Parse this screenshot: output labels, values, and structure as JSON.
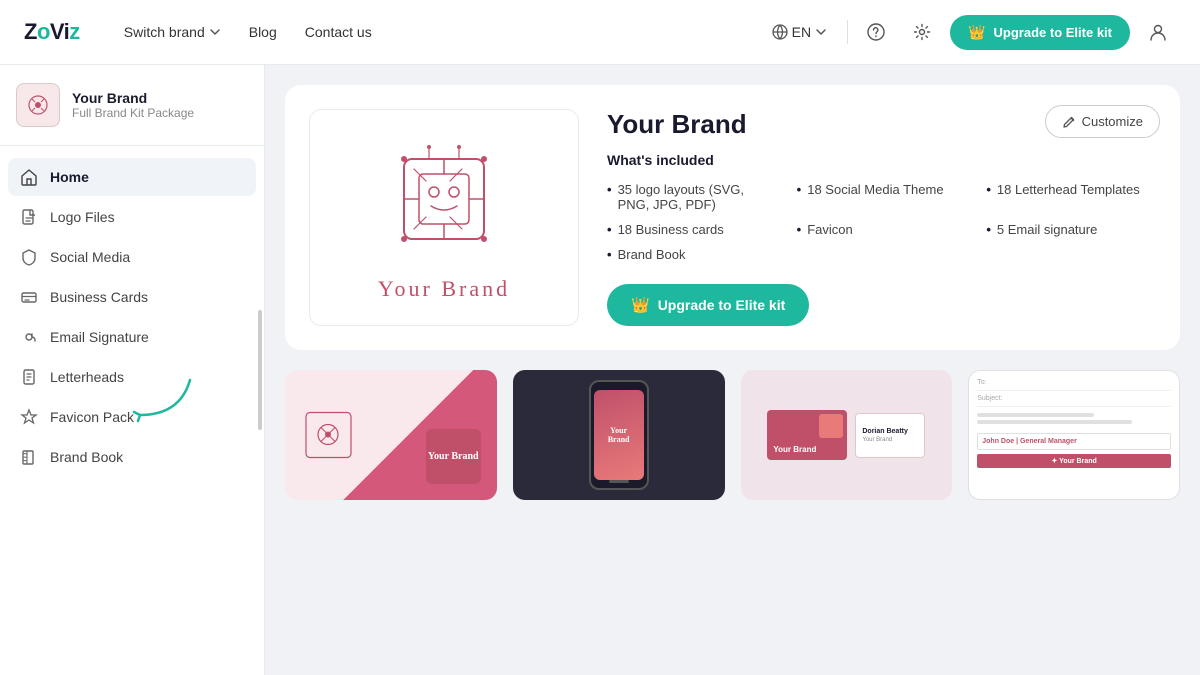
{
  "header": {
    "logo": "ZoViz",
    "nav": [
      {
        "label": "Switch brand",
        "hasDropdown": true
      },
      {
        "label": "Blog"
      },
      {
        "label": "Contact us"
      }
    ],
    "lang": "EN",
    "upgrade_label": "Upgrade to Elite kit",
    "help_icon": "help-circle",
    "settings_icon": "gear",
    "user_icon": "user"
  },
  "sidebar": {
    "brand_name": "Your Brand",
    "brand_package": "Full Brand Kit Package",
    "menu_items": [
      {
        "id": "home",
        "label": "Home",
        "icon": "home",
        "active": true
      },
      {
        "id": "logo-files",
        "label": "Logo Files",
        "icon": "file"
      },
      {
        "id": "social-media",
        "label": "Social Media",
        "icon": "shield"
      },
      {
        "id": "business-cards",
        "label": "Business Cards",
        "icon": "card"
      },
      {
        "id": "email-signature",
        "label": "Email Signature",
        "icon": "at"
      },
      {
        "id": "letterheads",
        "label": "Letterheads",
        "icon": "document"
      },
      {
        "id": "favicon-pack",
        "label": "Favicon Pack",
        "icon": "star"
      },
      {
        "id": "brand-book",
        "label": "Brand Book",
        "icon": "book"
      }
    ]
  },
  "brand_card": {
    "title": "Your Brand",
    "whats_included_label": "What's included",
    "logo_name": "Your Brand",
    "customize_label": "Customize",
    "upgrade_label": "Upgrade to Elite kit",
    "features": [
      {
        "col": 0,
        "text": "35 logo layouts (SVG, PNG, JPG, PDF)"
      },
      {
        "col": 1,
        "text": "18 Social Media Theme"
      },
      {
        "col": 2,
        "text": "18 Letterhead Templates"
      },
      {
        "col": 0,
        "text": "18 Business cards"
      },
      {
        "col": 1,
        "text": "Favicon"
      },
      {
        "col": 2,
        "text": "5 Email signature"
      },
      {
        "col": 0,
        "text": "Brand Book"
      }
    ]
  },
  "thumbnails": [
    {
      "id": "logo-thumb",
      "type": "logo"
    },
    {
      "id": "social-thumb",
      "type": "social"
    },
    {
      "id": "card-thumb",
      "type": "business-card"
    },
    {
      "id": "letterhead-thumb",
      "type": "letterhead"
    }
  ],
  "colors": {
    "accent": "#1db89e",
    "brand_pink": "#c0506a",
    "brand_bg": "#f5e8ea"
  }
}
